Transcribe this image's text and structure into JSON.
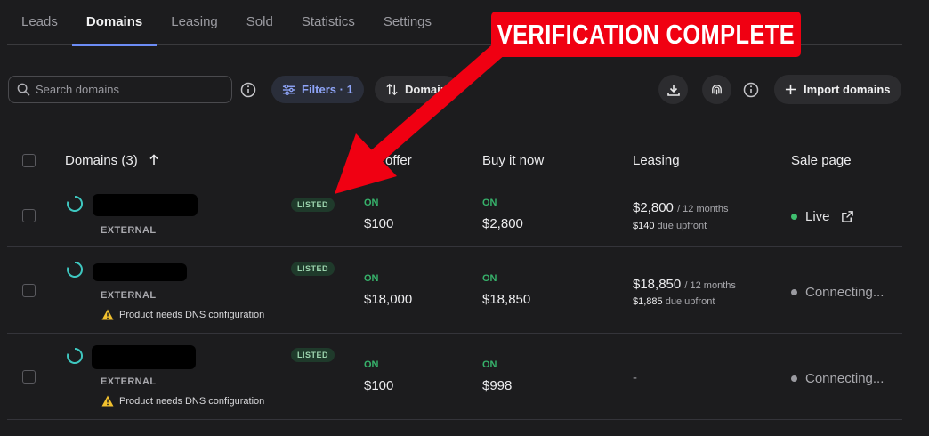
{
  "tabs": [
    {
      "label": "Leads"
    },
    {
      "label": "Domains"
    },
    {
      "label": "Leasing"
    },
    {
      "label": "Sold"
    },
    {
      "label": "Statistics"
    },
    {
      "label": "Settings"
    }
  ],
  "active_tab": "Domains",
  "toolbar": {
    "search_placeholder": "Search domains",
    "filters_label": "Filters · 1",
    "sort_label": "Domain",
    "import_label": "Import domains"
  },
  "table": {
    "headers": {
      "domains": "Domains (3)",
      "offer": "offer",
      "buy_now": "Buy it now",
      "leasing": "Leasing",
      "sale_page": "Sale page"
    },
    "rows": [
      {
        "type": "EXTERNAL",
        "badge": "LISTED",
        "offer_status": "ON",
        "offer_price": "$100",
        "buy_status": "ON",
        "buy_price": "$2,800",
        "lease_amount": "$2,800",
        "lease_period": "/ 12 months",
        "lease_upfront": "$140",
        "lease_upfront_label": "due upfront",
        "warning": "",
        "status": "Live",
        "status_color": "#3fbf6f"
      },
      {
        "type": "EXTERNAL",
        "badge": "LISTED",
        "offer_status": "ON",
        "offer_price": "$18,000",
        "buy_status": "ON",
        "buy_price": "$18,850",
        "lease_amount": "$18,850",
        "lease_period": "/ 12 months",
        "lease_upfront": "$1,885",
        "lease_upfront_label": "due upfront",
        "warning": "Product needs DNS configuration",
        "status": "Connecting...",
        "status_color": "#9a9aa0"
      },
      {
        "type": "EXTERNAL",
        "badge": "LISTED",
        "offer_status": "ON",
        "offer_price": "$100",
        "buy_status": "ON",
        "buy_price": "$998",
        "lease_dash": "-",
        "warning": "Product needs DNS configuration",
        "status": "Connecting...",
        "status_color": "#9a9aa0"
      }
    ]
  },
  "annotation": {
    "text": "VERIFICATION COMPLETE",
    "color": "#f00012"
  },
  "icons": [
    "search-icon",
    "info-icon",
    "filter-icon",
    "sort-icon",
    "download-icon",
    "fingerprint-icon",
    "plus-icon",
    "arrow-up-icon",
    "spinner-icon",
    "warning-icon",
    "external-link-icon"
  ]
}
